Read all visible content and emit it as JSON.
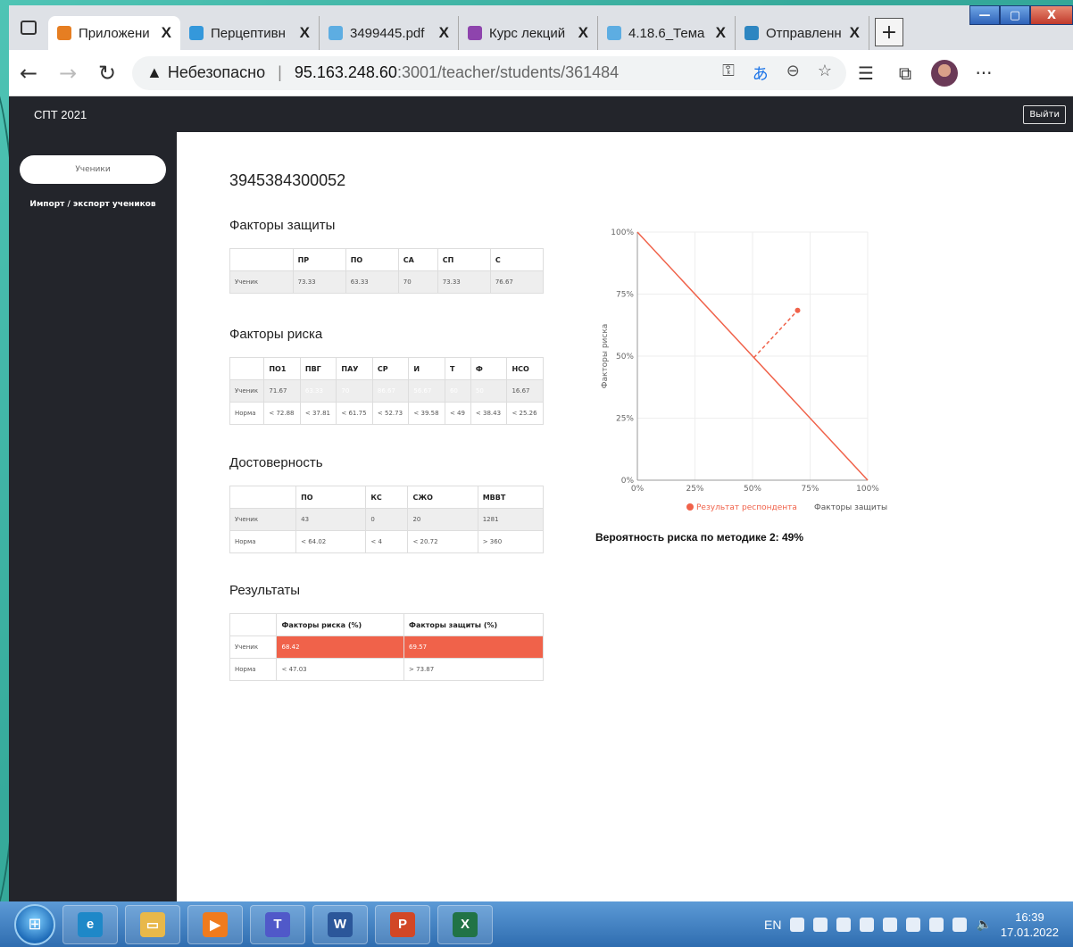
{
  "browser": {
    "tabs": [
      {
        "label": "Приложени",
        "color": "#e67e22",
        "active": true
      },
      {
        "label": "Перцептивн",
        "color": "#3498db",
        "active": false
      },
      {
        "label": "3499445.pdf",
        "color": "#5dade2",
        "active": false
      },
      {
        "label": "Курс лекций",
        "color": "#8e44ad",
        "active": false
      },
      {
        "label": "4.18.6_Тема",
        "color": "#5dade2",
        "active": false
      },
      {
        "label": "Отправленн",
        "color": "#2e86c1",
        "active": false
      }
    ],
    "tab_close": "X",
    "new_tab": "+",
    "window_controls": {
      "minimize": "—",
      "maximize": "▢",
      "close": "X"
    },
    "security_label": "Небезопасно",
    "url_host": "95.163.248.60",
    "url_path": ":3001/teacher/students/361484"
  },
  "app": {
    "brand": "СПТ 2021",
    "logout": "Выйти",
    "sidebar": {
      "students": "Ученики",
      "import_export": "Импорт / экспорт учеников"
    },
    "student_id": "3945384300052"
  },
  "protection": {
    "title": "Факторы защиты",
    "headers": [
      "",
      "ПР",
      "ПО",
      "СА",
      "СП",
      "С"
    ],
    "row_label": "Ученик",
    "values": [
      "73.33",
      "63.33",
      "70",
      "73.33",
      "76.67"
    ]
  },
  "risk": {
    "title": "Факторы риска",
    "headers": [
      "",
      "ПО1",
      "ПВГ",
      "ПАУ",
      "СР",
      "И",
      "Т",
      "Ф",
      "НСО"
    ],
    "student_label": "Ученик",
    "student_values": [
      "71.67",
      "63.33",
      "70",
      "86.67",
      "56.67",
      "60",
      "50",
      "16.67"
    ],
    "norm_label": "Норма",
    "norm_values": [
      "< 72.88",
      "< 37.81",
      "< 61.75",
      "< 52.73",
      "< 39.58",
      "< 49",
      "< 38.43",
      "< 25.26"
    ],
    "highlight": [
      false,
      true,
      true,
      true,
      true,
      true,
      true,
      false
    ]
  },
  "reliability": {
    "title": "Достоверность",
    "headers": [
      "",
      "ПО",
      "КС",
      "СЖО",
      "МВВТ"
    ],
    "student_label": "Ученик",
    "student_values": [
      "43",
      "0",
      "20",
      "1281"
    ],
    "norm_label": "Норма",
    "norm_values": [
      "< 64.02",
      "< 4",
      "< 20.72",
      "> 360"
    ]
  },
  "results": {
    "title": "Результаты",
    "headers": [
      "",
      "Факторы риска (%)",
      "Факторы защиты (%)"
    ],
    "student_label": "Ученик",
    "student_values": [
      "68.42",
      "69.57"
    ],
    "norm_label": "Норма",
    "norm_values": [
      "< 47.03",
      "> 73.87"
    ]
  },
  "chart_data": {
    "type": "scatter",
    "xlabel": "Факторы защиты",
    "ylabel": "Факторы риска",
    "xlim": [
      0,
      100
    ],
    "ylim": [
      0,
      100
    ],
    "x_ticks": [
      "0%",
      "25%",
      "50%",
      "75%",
      "100%"
    ],
    "y_ticks": [
      "0%",
      "25%",
      "50%",
      "75%",
      "100%"
    ],
    "grid": true,
    "boundary_line": [
      [
        0,
        100
      ],
      [
        100,
        0
      ]
    ],
    "series": [
      {
        "name": "Результат респондента",
        "x": [
          69.57
        ],
        "y": [
          68.42
        ],
        "color": "#f0624a"
      }
    ],
    "projection_from": [
      50.6,
      49.4
    ],
    "legend_position": "bottom"
  },
  "risk_probability": "Вероятность риска по методике 2: 49%",
  "taskbar": {
    "apps": [
      {
        "name": "edge",
        "glyph": "e",
        "color": "#1e88c8"
      },
      {
        "name": "explorer",
        "glyph": "▭",
        "color": "#e8b84a"
      },
      {
        "name": "media",
        "glyph": "▶",
        "color": "#f07b1d"
      },
      {
        "name": "teams",
        "glyph": "T",
        "color": "#5059c9"
      },
      {
        "name": "word",
        "glyph": "W",
        "color": "#2b579a"
      },
      {
        "name": "powerpoint",
        "glyph": "P",
        "color": "#d24726"
      },
      {
        "name": "excel",
        "glyph": "X",
        "color": "#217346"
      }
    ],
    "lang": "EN",
    "time": "16:39",
    "date": "17.01.2022"
  }
}
